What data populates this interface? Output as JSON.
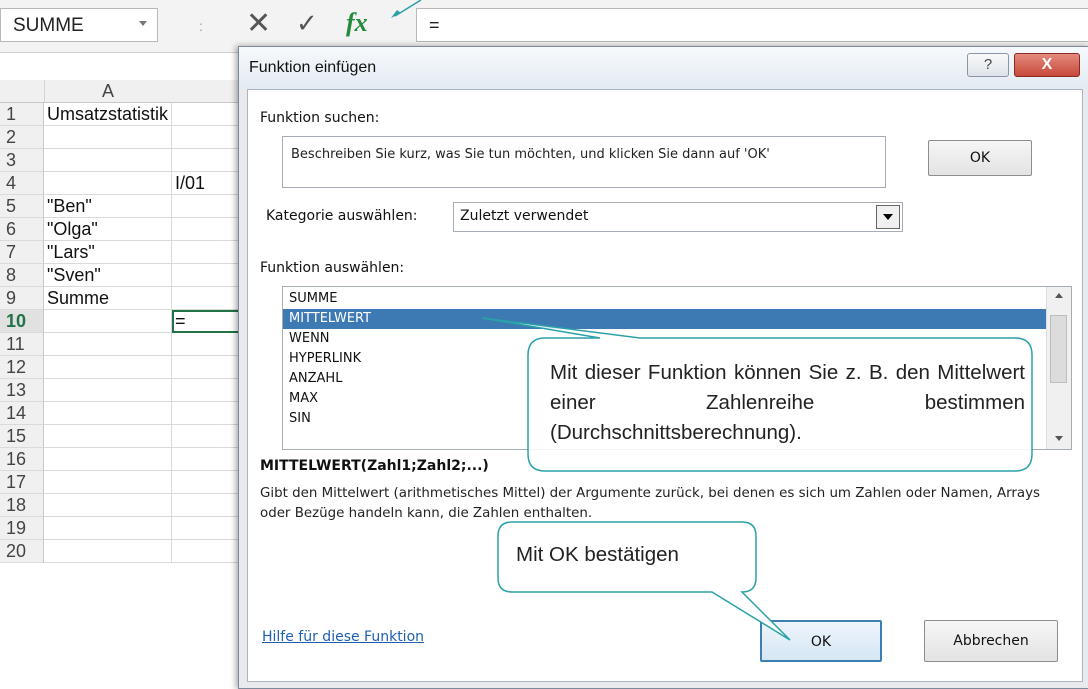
{
  "formula_bar": {
    "name_box": "SUMME",
    "separator": ":",
    "cancel_glyph": "✕",
    "enter_glyph": "✓",
    "fx_label": "fx",
    "formula": "="
  },
  "sheet": {
    "columns": [
      "A"
    ],
    "rows": [
      {
        "num": "1",
        "a": "Umsatzstatistik",
        "b": ""
      },
      {
        "num": "2",
        "a": "",
        "b": ""
      },
      {
        "num": "3",
        "a": "",
        "b": ""
      },
      {
        "num": "4",
        "a": "",
        "b": "I/01"
      },
      {
        "num": "5",
        "a": "\"Ben\"",
        "b": ""
      },
      {
        "num": "6",
        "a": "\"Olga\"",
        "b": ""
      },
      {
        "num": "7",
        "a": "\"Lars\"",
        "b": ""
      },
      {
        "num": "8",
        "a": "\"Sven\"",
        "b": ""
      },
      {
        "num": "9",
        "a": "Summe",
        "b": ""
      },
      {
        "num": "10",
        "a": "",
        "b": "="
      },
      {
        "num": "11",
        "a": "",
        "b": ""
      },
      {
        "num": "12",
        "a": "",
        "b": ""
      },
      {
        "num": "13",
        "a": "",
        "b": ""
      },
      {
        "num": "14",
        "a": "",
        "b": ""
      },
      {
        "num": "15",
        "a": "",
        "b": ""
      },
      {
        "num": "16",
        "a": "",
        "b": ""
      },
      {
        "num": "17",
        "a": "",
        "b": ""
      },
      {
        "num": "18",
        "a": "",
        "b": ""
      },
      {
        "num": "19",
        "a": "",
        "b": ""
      },
      {
        "num": "20",
        "a": "",
        "b": ""
      }
    ]
  },
  "dialog": {
    "title": "Funktion einfügen",
    "help_glyph": "?",
    "close_glyph": "X",
    "search_label": "Funktion suchen:",
    "search_text": "Beschreiben Sie kurz, was Sie tun möchten, und klicken Sie dann auf 'OK'",
    "ok_top": "OK",
    "category_label": "Kategorie auswählen:",
    "category_value": "Zuletzt verwendet",
    "function_label": "Funktion auswählen:",
    "functions": [
      "SUMME",
      "MITTELWERT",
      "WENN",
      "HYPERLINK",
      "ANZAHL",
      "MAX",
      "SIN"
    ],
    "selected_function": "MITTELWERT",
    "syntax": "MITTELWERT(Zahl1;Zahl2;...)",
    "description": "Gibt den Mittelwert (arithmetisches Mittel) der Argumente zurück, bei denen es sich um Zahlen oder Namen, Arrays oder Bezüge handeln kann, die Zahlen enthalten.",
    "help_link": "Hilfe für diese Funktion",
    "ok_button": "OK",
    "cancel_button": "Abbrechen"
  },
  "callouts": {
    "function_hint": "Mit dieser Funktion können Sie z. B. den Mittelwert einer Zahlenreihe bestimmen (Durchschnittsberechnung).",
    "ok_hint": "Mit OK bestätigen"
  },
  "colors": {
    "excel_green": "#217346",
    "selection_blue": "#3d7ab3",
    "callout_border": "#2aa1a8",
    "close_red": "#c6483a"
  }
}
